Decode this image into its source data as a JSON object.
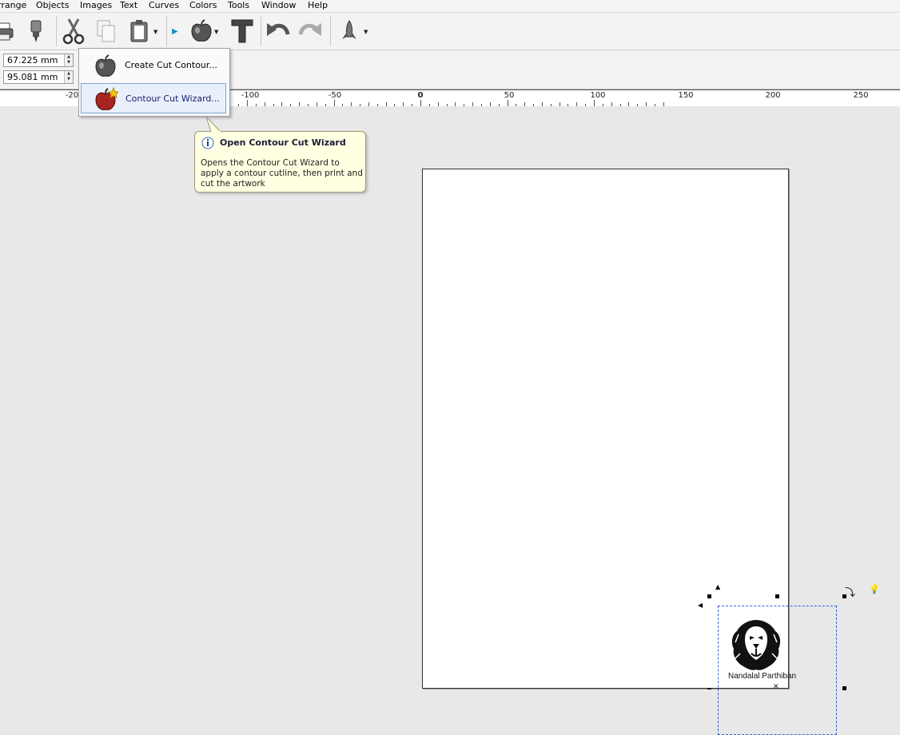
{
  "menubar": {
    "items": [
      "rrange",
      "Objects",
      "Images",
      "Text",
      "Curves",
      "Colors",
      "Tools",
      "Window",
      "Help"
    ]
  },
  "toolbar": {
    "icons": [
      "printer-icon",
      "cutter-icon",
      "scissors-icon",
      "copy-icon",
      "paste-icon",
      "play-arrow-icon",
      "apple-contour-icon",
      "text-tool-icon",
      "undo-icon",
      "redo-icon",
      "rocket-icon"
    ]
  },
  "propbar": {
    "x_value": "67.225 mm",
    "y_value": "95.081 mm"
  },
  "ruler": {
    "labels": [
      "-20",
      "-100",
      "-50",
      "0",
      "50",
      "100",
      "150",
      "200",
      "250"
    ]
  },
  "dropdown": {
    "item1": "Create Cut Contour...",
    "item2": "Contour Cut Wizard..."
  },
  "tooltip": {
    "title": "Open Contour Cut Wizard",
    "body": "Opens the Contour Cut Wizard to apply a contour cutline, then print and cut the artwork"
  },
  "artwork": {
    "caption": "Nandalal Parthiban"
  }
}
